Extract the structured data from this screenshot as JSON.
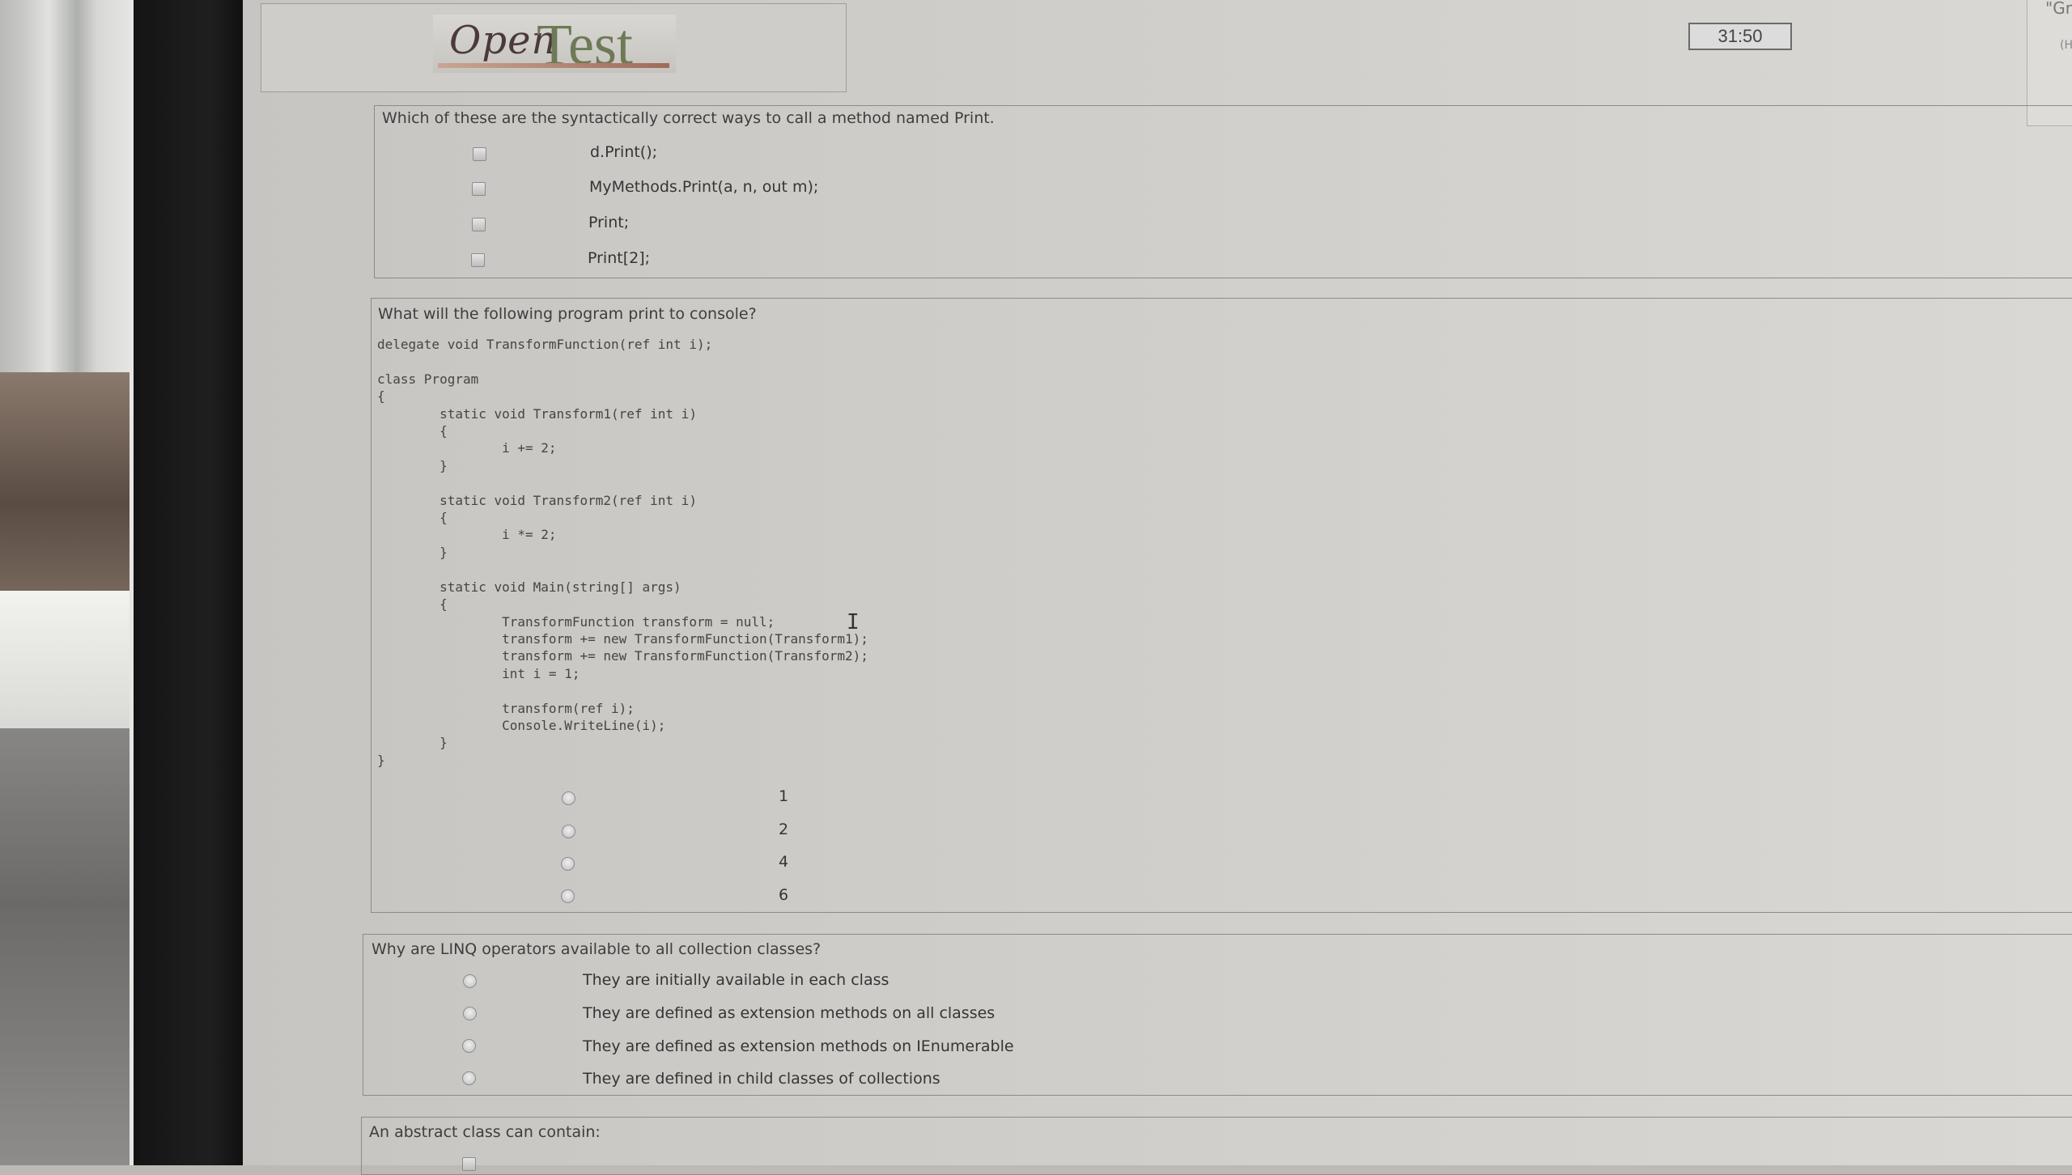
{
  "header": {
    "logo_open": "Open",
    "logo_test": "Test",
    "timer": "31:50",
    "right_panel_text_1": "\"Gr",
    "right_panel_text_2": "(H"
  },
  "questions": [
    {
      "text": "Which of these are the syntactically correct ways to call a method named Print.",
      "input": "checkbox",
      "options": [
        "d.Print();",
        "MyMethods.Print(a, n, out m);",
        "Print;",
        "Print[2];"
      ]
    },
    {
      "text": "What will the following program print to console?",
      "code": "delegate void TransformFunction(ref int i);\n\nclass Program\n{\n        static void Transform1(ref int i)\n        {\n                i += 2;\n        }\n\n        static void Transform2(ref int i)\n        {\n                i *= 2;\n        }\n\n        static void Main(string[] args)\n        {\n                TransformFunction transform = null;\n                transform += new TransformFunction(Transform1);\n                transform += new TransformFunction(Transform2);\n                int i = 1;\n\n                transform(ref i);\n                Console.WriteLine(i);\n        }\n}",
      "input": "radio",
      "options": [
        "1",
        "2",
        "4",
        "6"
      ]
    },
    {
      "text": "Why are LINQ operators available to all collection classes?",
      "input": "radio",
      "options": [
        "They are initially available in each class",
        "They are defined as extension methods on all classes",
        "They are defined as extension methods on IEnumerable",
        "They are defined in child classes of collections"
      ]
    },
    {
      "text": "An abstract class can contain:",
      "input": "checkbox",
      "options": []
    }
  ]
}
